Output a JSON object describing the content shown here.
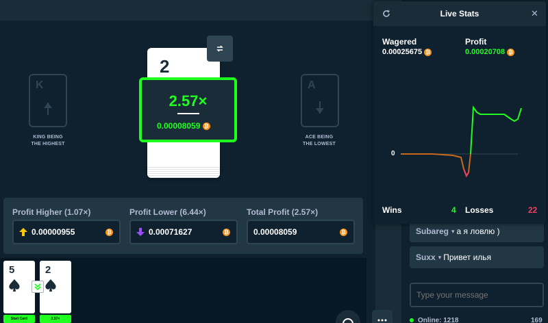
{
  "game": {
    "left_card": {
      "letter": "K",
      "label_line1": "KING BEING",
      "label_line2": "THE HIGHEST"
    },
    "right_card": {
      "letter": "A",
      "label_line1": "ACE BEING",
      "label_line2": "THE LOWEST"
    },
    "current_card_rank": "2",
    "result": {
      "multiplier": "2.57×",
      "amount": "0.00008059"
    }
  },
  "bet_panel": {
    "fields": [
      {
        "label": "Profit Higher (1.07×)",
        "value": "0.00000955",
        "icon": "arrow-up-icon"
      },
      {
        "label": "Profit Lower (6.44×)",
        "value": "0.00071627",
        "icon": "arrow-down-icon"
      },
      {
        "label": "Total Profit (2.57×)",
        "value": "0.00008059",
        "icon": ""
      }
    ]
  },
  "history": [
    {
      "rank": "5",
      "tag": "Start Card"
    },
    {
      "rank": "2",
      "tag": "2.57×"
    }
  ],
  "live_stats": {
    "title": "Live Stats",
    "wagered_label": "Wagered",
    "wagered_value": "0.00025675",
    "profit_label": "Profit",
    "profit_value": "0.00020708",
    "zero_label": "0",
    "wins_label": "Wins",
    "wins_value": "4",
    "losses_label": "Losses",
    "losses_value": "22",
    "colors": {
      "positive": "#1fff20",
      "negative": "#ed4163",
      "neutral": "#c8691c"
    }
  },
  "chat": {
    "messages": [
      {
        "user": "Subareg",
        "text": "а я ловлю )"
      },
      {
        "user": "Suxx",
        "text": "Привет илья"
      }
    ],
    "input_placeholder": "Type your message",
    "online": "Online: 1218",
    "right_count": "169"
  }
}
